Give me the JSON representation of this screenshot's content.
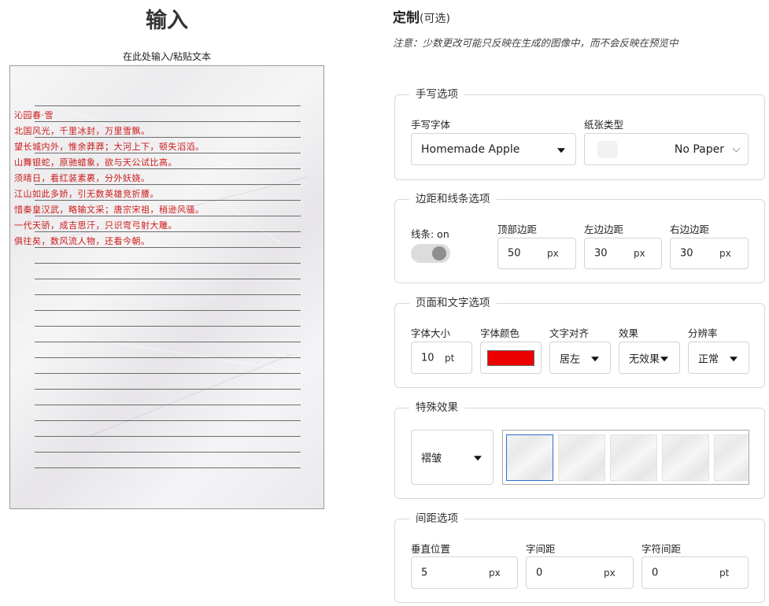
{
  "input": {
    "title": "输入",
    "paste_label": "在此处输入/粘贴文本",
    "lines": [
      "沁园春·雪",
      "北国风光，千里冰封，万里雪飘。",
      "望长城内外，惟余莽莽；大河上下，顿失滔滔。",
      "山舞银蛇，原驰蜡象，欲与天公试比高。",
      "须晴日，看红装素裹，分外妖娆。",
      "江山如此多娇，引无数英雄竞折腰。",
      "惜秦皇汉武，略输文采；唐宗宋祖，稍逊风骚。",
      "一代天骄，成吉思汗，只识弯弓射大雕。",
      "俱往矣，数风流人物，还看今朝。"
    ]
  },
  "customize": {
    "title": "定制",
    "optional": "(可选)",
    "notice": "注意：少数更改可能只反映在生成的图像中，而不会反映在预览中"
  },
  "handwriting": {
    "legend": "手写选项",
    "font_label": "手写字体",
    "font_value": "Homemade Apple",
    "paper_label": "纸张类型",
    "paper_value": "No Paper"
  },
  "margins": {
    "legend": "边距和线条选项",
    "lines_label": "线条: on",
    "top_label": "顶部边距",
    "top_value": "50",
    "left_label": "左边边距",
    "left_value": "30",
    "right_label": "右边边距",
    "right_value": "30",
    "unit": "px"
  },
  "page_text": {
    "legend": "页面和文字选项",
    "size_label": "字体大小",
    "size_value": "10",
    "size_unit": "pt",
    "color_label": "字体颜色",
    "color_value": "#ee0000",
    "align_label": "文字对齐",
    "align_value": "居左",
    "effect_label": "效果",
    "effect_value": "无效果",
    "resolution_label": "分辨率",
    "resolution_value": "正常"
  },
  "special": {
    "legend": "特殊效果",
    "effect_value": "褶皱"
  },
  "spacing": {
    "legend": "间距选项",
    "vertical_label": "垂直位置",
    "vertical_value": "5",
    "vertical_unit": "px",
    "word_label": "字间距",
    "word_value": "0",
    "word_unit": "px",
    "char_label": "字符间距",
    "char_value": "0",
    "char_unit": "pt"
  }
}
